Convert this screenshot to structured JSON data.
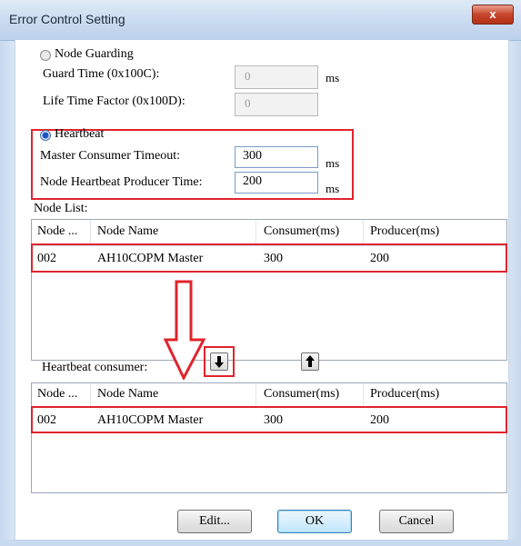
{
  "window": {
    "title": "Error Control Setting",
    "close_label": "x"
  },
  "node_guarding": {
    "label": "Node Guarding",
    "selected": false,
    "guard_time_label": "Guard Time (0x100C):",
    "guard_time_value": "0",
    "guard_time_unit": "ms",
    "life_time_label": "Life Time Factor (0x100D):",
    "life_time_value": "0"
  },
  "heartbeat": {
    "label": "Heartbeat",
    "selected": true,
    "consumer_timeout_label": "Master Consumer Timeout:",
    "consumer_timeout_value": "300",
    "consumer_timeout_unit": "ms",
    "producer_time_label": "Node Heartbeat Producer Time:",
    "producer_time_value": "200",
    "producer_time_unit": "ms"
  },
  "node_list": {
    "label": "Node List:",
    "columns": [
      "Node ...",
      "Node Name",
      "Consumer(ms)",
      "Producer(ms)"
    ],
    "rows": [
      [
        "002",
        "AH10COPM Master",
        "300",
        "200"
      ]
    ]
  },
  "heartbeat_consumer": {
    "label": "Heartbeat consumer:",
    "columns": [
      "Node ...",
      "Node Name",
      "Consumer(ms)",
      "Producer(ms)"
    ],
    "rows": [
      [
        "002",
        "AH10COPM Master",
        "300",
        "200"
      ]
    ]
  },
  "buttons": {
    "edit": "Edit...",
    "ok": "OK",
    "cancel": "Cancel"
  },
  "colors": {
    "highlight": "#e0242d",
    "selected_radio": "#1b52c9"
  }
}
